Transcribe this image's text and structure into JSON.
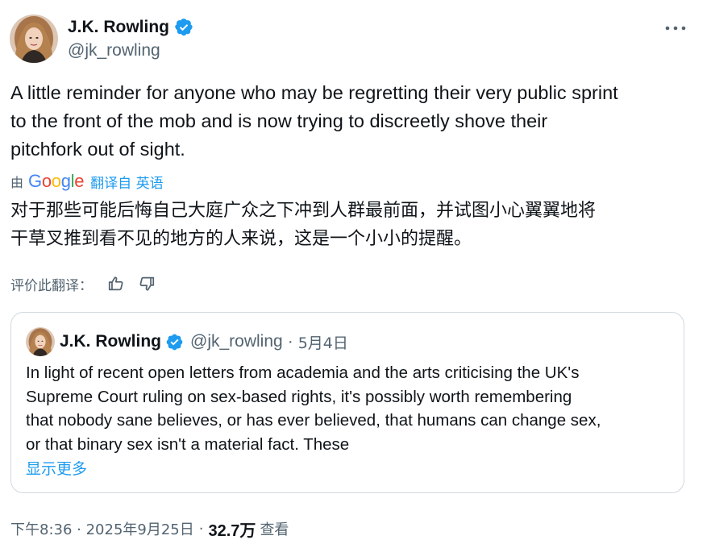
{
  "author": {
    "display_name": "J.K. Rowling",
    "handle": "@jk_rowling",
    "verified": true,
    "verified_color": "#1d9bf0"
  },
  "more_icon": "more-horizontal-icon",
  "tweet": {
    "text_lines": [
      "A little reminder for anyone who may be regretting their very public sprint",
      "to the front of the mob and is now trying to discreetly shove their",
      "pitchfork out of sight."
    ]
  },
  "translation": {
    "by_label": "由",
    "provider": "Google",
    "link": "翻译自 英语",
    "text_lines": [
      "对于那些可能后悔自己大庭广众之下冲到人群最前面，并试图小心翼翼地将",
      "干草叉推到看不见的地方的人来说，这是一个小小的提醒。"
    ],
    "rate_label": "评价此翻译：",
    "rate_icons": [
      "thumbs-up-icon",
      "thumbs-down-icon"
    ]
  },
  "quote": {
    "display_name": "J.K. Rowling",
    "handle": "@jk_rowling",
    "separator": "·",
    "date": "5月4日",
    "text_lines": [
      "In light of recent open letters from academia and the arts criticising the UK's",
      "Supreme Court ruling on sex-based rights, it's possibly worth remembering",
      "that nobody sane believes, or has ever believed, that humans can change sex,",
      "or that binary sex isn't a material fact. These"
    ],
    "show_more": "显示更多"
  },
  "meta": {
    "time": "下午8:36 · 2025年9月25日",
    "separator": "·",
    "views_count": "32.7万",
    "views_label": "查看"
  },
  "colors": {
    "text_primary": "#0f1419",
    "text_secondary": "#536471",
    "accent": "#1d9bf0",
    "border": "#cfd9de"
  }
}
